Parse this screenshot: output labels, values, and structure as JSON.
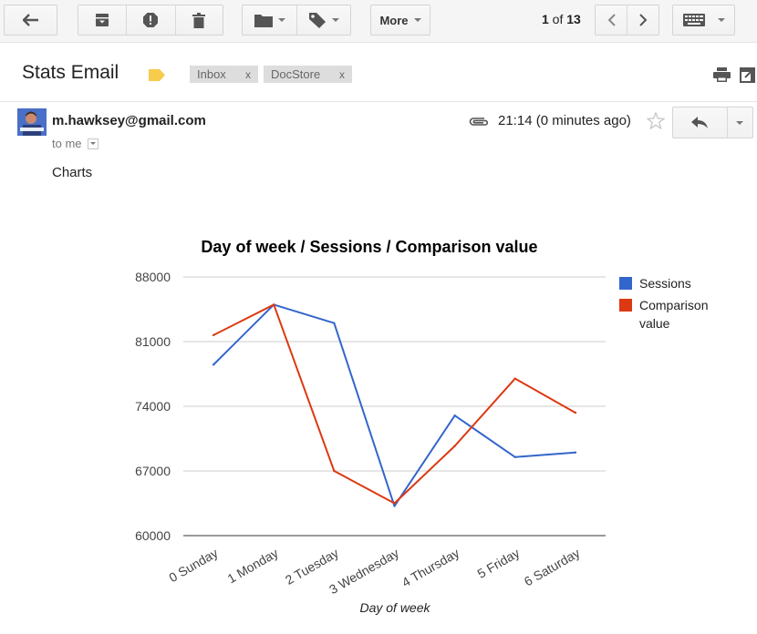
{
  "toolbar": {
    "more_label": "More",
    "pager_current": "1",
    "pager_of": " of ",
    "pager_total": "13"
  },
  "subject": {
    "title": "Stats Email",
    "labels": [
      {
        "name": "Inbox",
        "remove": "x"
      },
      {
        "name": "DocStore",
        "remove": "x"
      }
    ]
  },
  "message": {
    "sender": "m.hawksey@gmail.com",
    "recipient_label": "to me",
    "time": "21:14 (0 minutes ago)",
    "body": "Charts"
  },
  "colors": {
    "sessions": "#3366cc",
    "comparison": "#dc3912",
    "label_tag": "#f7cb4d"
  },
  "chart_data": {
    "type": "line",
    "title": "Day of week / Sessions / Comparison value",
    "xlabel": "Day of week",
    "ylabel": "",
    "categories": [
      "0 Sunday",
      "1 Monday",
      "2 Tuesday",
      "3 Wednesday",
      "4 Thursday",
      "5 Friday",
      "6 Saturday"
    ],
    "ylim": [
      60000,
      88000
    ],
    "yticks": [
      "60000",
      "67000",
      "74000",
      "81000",
      "88000"
    ],
    "grid": true,
    "legend_position": "right",
    "series": [
      {
        "name": "Sessions",
        "values": [
          78500,
          85000,
          83000,
          63200,
          73000,
          68500,
          69000
        ]
      },
      {
        "name": "Comparison value",
        "values": [
          81700,
          85000,
          67000,
          63500,
          69700,
          77000,
          73300
        ]
      }
    ]
  }
}
